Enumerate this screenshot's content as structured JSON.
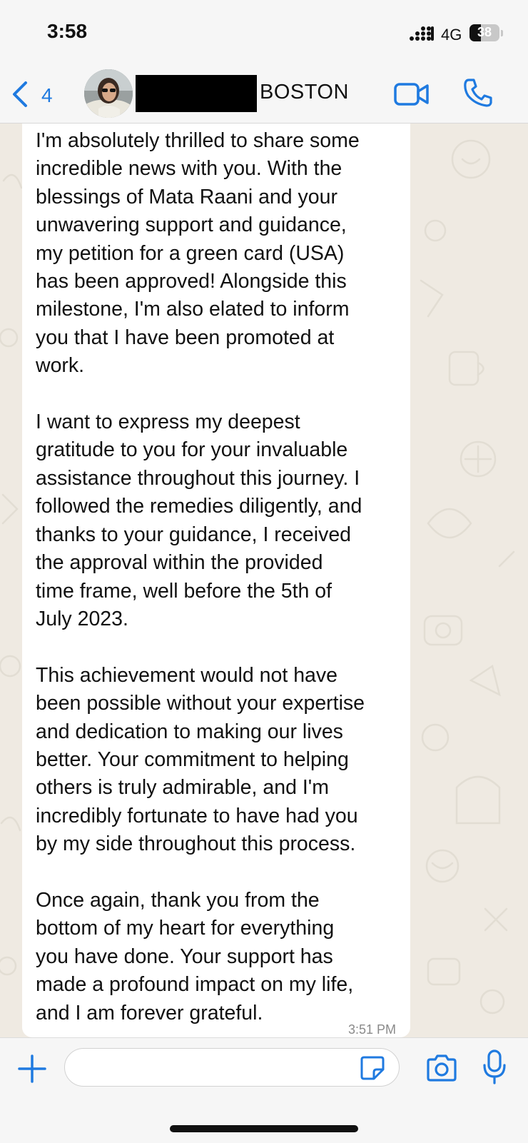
{
  "status_bar": {
    "time": "3:58",
    "network": "4G",
    "battery": "38",
    "battery_level": 0.38,
    "icons": [
      "signal-icon",
      "battery-icon"
    ]
  },
  "header": {
    "back_count": "4",
    "contact_name": "BOSTON",
    "icons": [
      "chevron-left-icon",
      "video-camera-icon",
      "phone-icon"
    ],
    "accent_color": "#1f7ae0"
  },
  "message": {
    "direction": "incoming",
    "text": "I'm absolutely thrilled to share some\nincredible news with you. With the\nblessings of Mata Raani and your\nunwavering support and guidance,\nmy petition for a green card (USA)\nhas been approved! Alongside this\nmilestone, I'm also elated to inform\nyou that I have been promoted at\nwork.\n\nI want to express my deepest\ngratitude to you for your invaluable\nassistance throughout this journey. I\nfollowed the remedies diligently, and\nthanks to your guidance, I received\nthe approval within the provided\ntime frame, well before the 5th of\nJuly 2023.\n\nThis achievement would not have\nbeen possible without your expertise\nand dedication to making our lives\nbetter. Your commitment to helping\nothers is truly admirable, and I'm\nincredibly fortunate to have had you\nby my side throughout this process.\n\nOnce again, thank you from the\nbottom of my heart for everything\nyou have done. Your support has\nmade a profound impact on my life,\nand I am forever grateful.",
    "time": "3:51 PM"
  },
  "input_bar": {
    "value": "",
    "icons": [
      "plus-icon",
      "sticker-icon",
      "camera-icon",
      "microphone-icon"
    ]
  },
  "colors": {
    "chat_background": "#efeae2",
    "bubble": "#ffffff",
    "bar_background": "#f6f6f6"
  }
}
